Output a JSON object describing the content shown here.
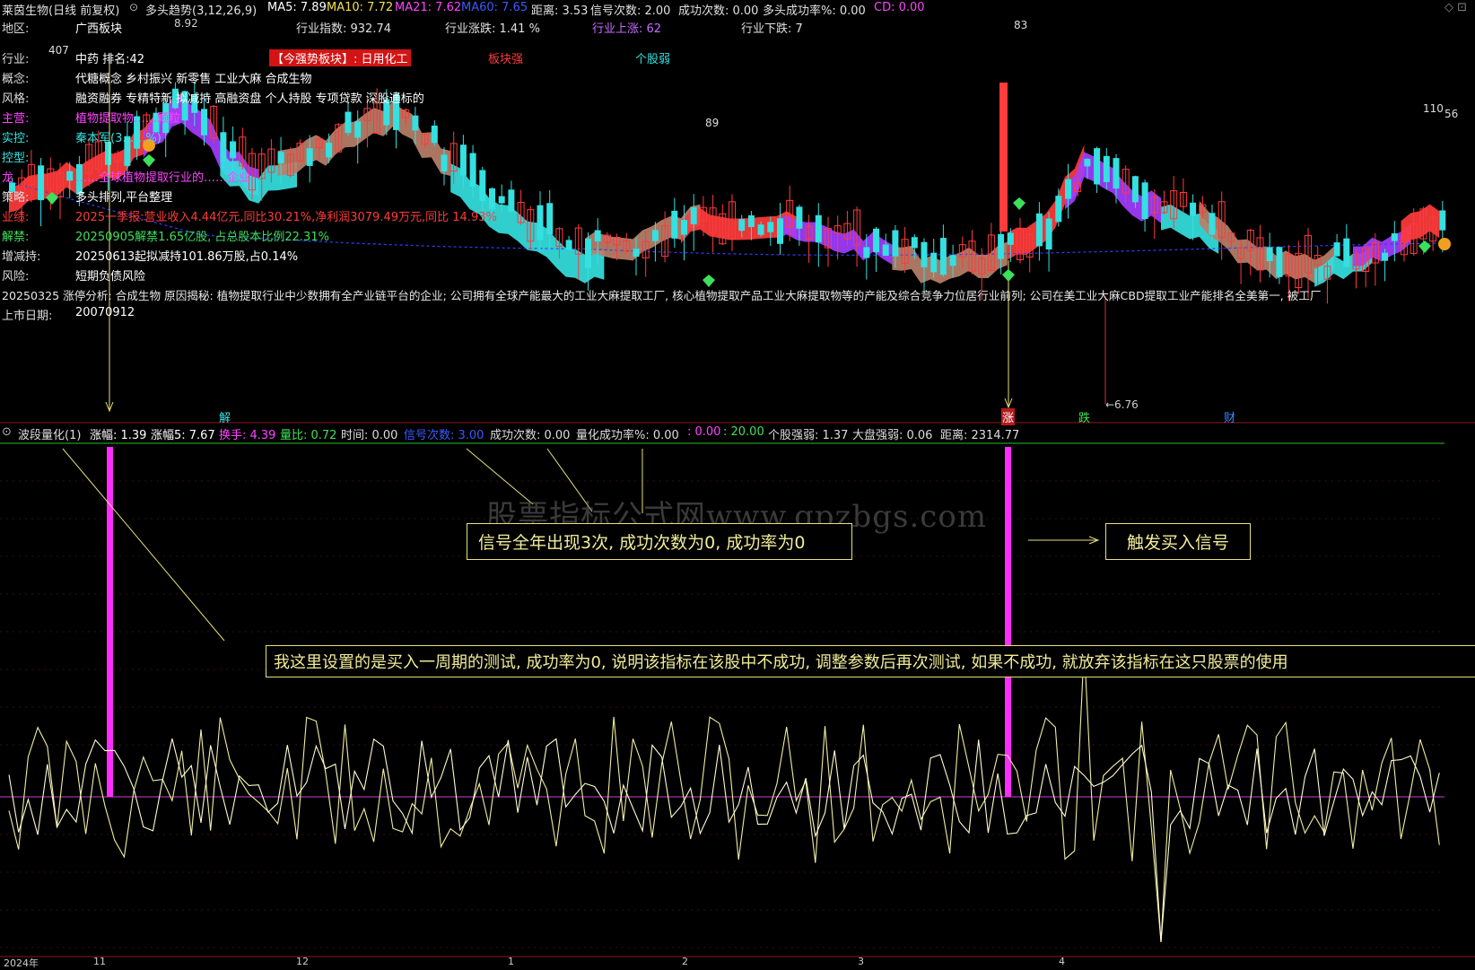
{
  "header": {
    "title": "莱茵生物(日线 前复权)",
    "indicator": "多头趋势(3,12,26,9)",
    "ma5": "MA5: 7.89",
    "ma10": "MA10: 7.72",
    "ma21": "MA21: 7.62",
    "ma60": "MA60: 7.65",
    "distance": "距离: 3.53",
    "signal_count": "信号次数: 2.00",
    "success_count": "成功次数: 0.00",
    "bull_rate": "多头成功率%: 0.00",
    "cd": "CD: 0.00"
  },
  "info": {
    "region_label": "地区:",
    "region": "广西板块",
    "index_label": "行业指数: 932.74",
    "change_label": "行业涨跌: 1.41 %",
    "up_label": "行业上涨: 62",
    "down_label": "行业下跌: 7",
    "industry_label": "行业:",
    "industry": "中药 排名:42",
    "strong_sector": "【今强势板块】: 日用化工",
    "sector_strong": "板块强",
    "stock_weak": "个股弱",
    "concept_label": "概念:",
    "concept": "代糖概念 乡村振兴 新零售 工业大麻 合成生物",
    "style_label": "风格:",
    "style": "融资融券 专精特新 拟减持 高融资盘 个人持股 专项贷款 深股通标的",
    "main_label": "主营:",
    "main": "植物提取物……颗粒",
    "control_label": "实控:",
    "control": "秦本军(3……%)",
    "controltype_label": "控型:",
    "leader_label": "龙",
    "leader": "……全球植物提取行业的……企业",
    "strategy_label": "策略:",
    "strategy": "多头排列,平台整理",
    "perf_label": "业绩:",
    "perf": "2025一季报:营业收入4.44亿元,同比30.21%,净利润3079.49万元,同比 14.93%",
    "unlock_label": "解禁:",
    "unlock": "20250905解禁1.65亿股, 占总股本比例22.31%",
    "reduce_label": "增减持:",
    "reduce": "20250613起拟减持101.86万股,占0.14%",
    "risk_label": "风险:",
    "risk": "短期负债风险",
    "analysis": "20250325 涨停分析: 合成生物 原因揭秘: 植物提取行业中少数拥有全产业链平台的企业; 公司拥有全球产能最大的工业大麻提取工厂, 核心植物提取产品工业大麻提取物等的产能及综合竞争力位居行业前列; 公司在美工业大麻CBD提取工业产能排名全美第一, 被工厂",
    "listing_label": "上市日期:",
    "listing": "20070912"
  },
  "price_labels": {
    "p892": "8.92",
    "p407": "407",
    "p83": "83",
    "p89": "89",
    "p110": "110",
    "p56": "56",
    "p676": "←6.76"
  },
  "markers": {
    "jie": "解",
    "zhang": "涨",
    "die": "跌",
    "cai": "财"
  },
  "sub": {
    "name": "波段量化(1)",
    "amp": "涨幅: 1.39",
    "amp5": "涨幅5: 7.67",
    "turnover": "换手: 4.39",
    "volratio": "量比: 0.72",
    "time": "时间: 0.00",
    "sigcount": "信号次数: 3.00",
    "succ": "成功次数: 0.00",
    "rate": "量化成功率%: 0.00",
    "v1": ": 0.00",
    "v2": ": 20.00",
    "stock_strength": "个股强弱: 1.37",
    "market_strength": "大盘强弱: 0.06",
    "dist": "距离: 2314.77"
  },
  "annotations": {
    "box1": "信号全年出现3次, 成功次数为0, 成功率为0",
    "box2": "触发买入信号",
    "box3": "我这里设置的是买入一周期的测试, 成功率为0, 说明该指标在该股中不成功, 调整参数后再次测试, 如果不成功, 就放弃该指标在这只股票的使用",
    "watermark": "股票指标公式网www.gpzbgs.com"
  },
  "axis": {
    "year": "2024年",
    "m11": "11",
    "m12": "12",
    "m1": "1",
    "m2": "2",
    "m3": "3",
    "m4": "4"
  },
  "colors": {
    "up": "#ff3b3b",
    "down": "#35e0e0",
    "purple": "#a23cff",
    "tan": "#b9806a",
    "magenta": "#ff2cff",
    "yellow_line": "#f2eea0"
  }
}
